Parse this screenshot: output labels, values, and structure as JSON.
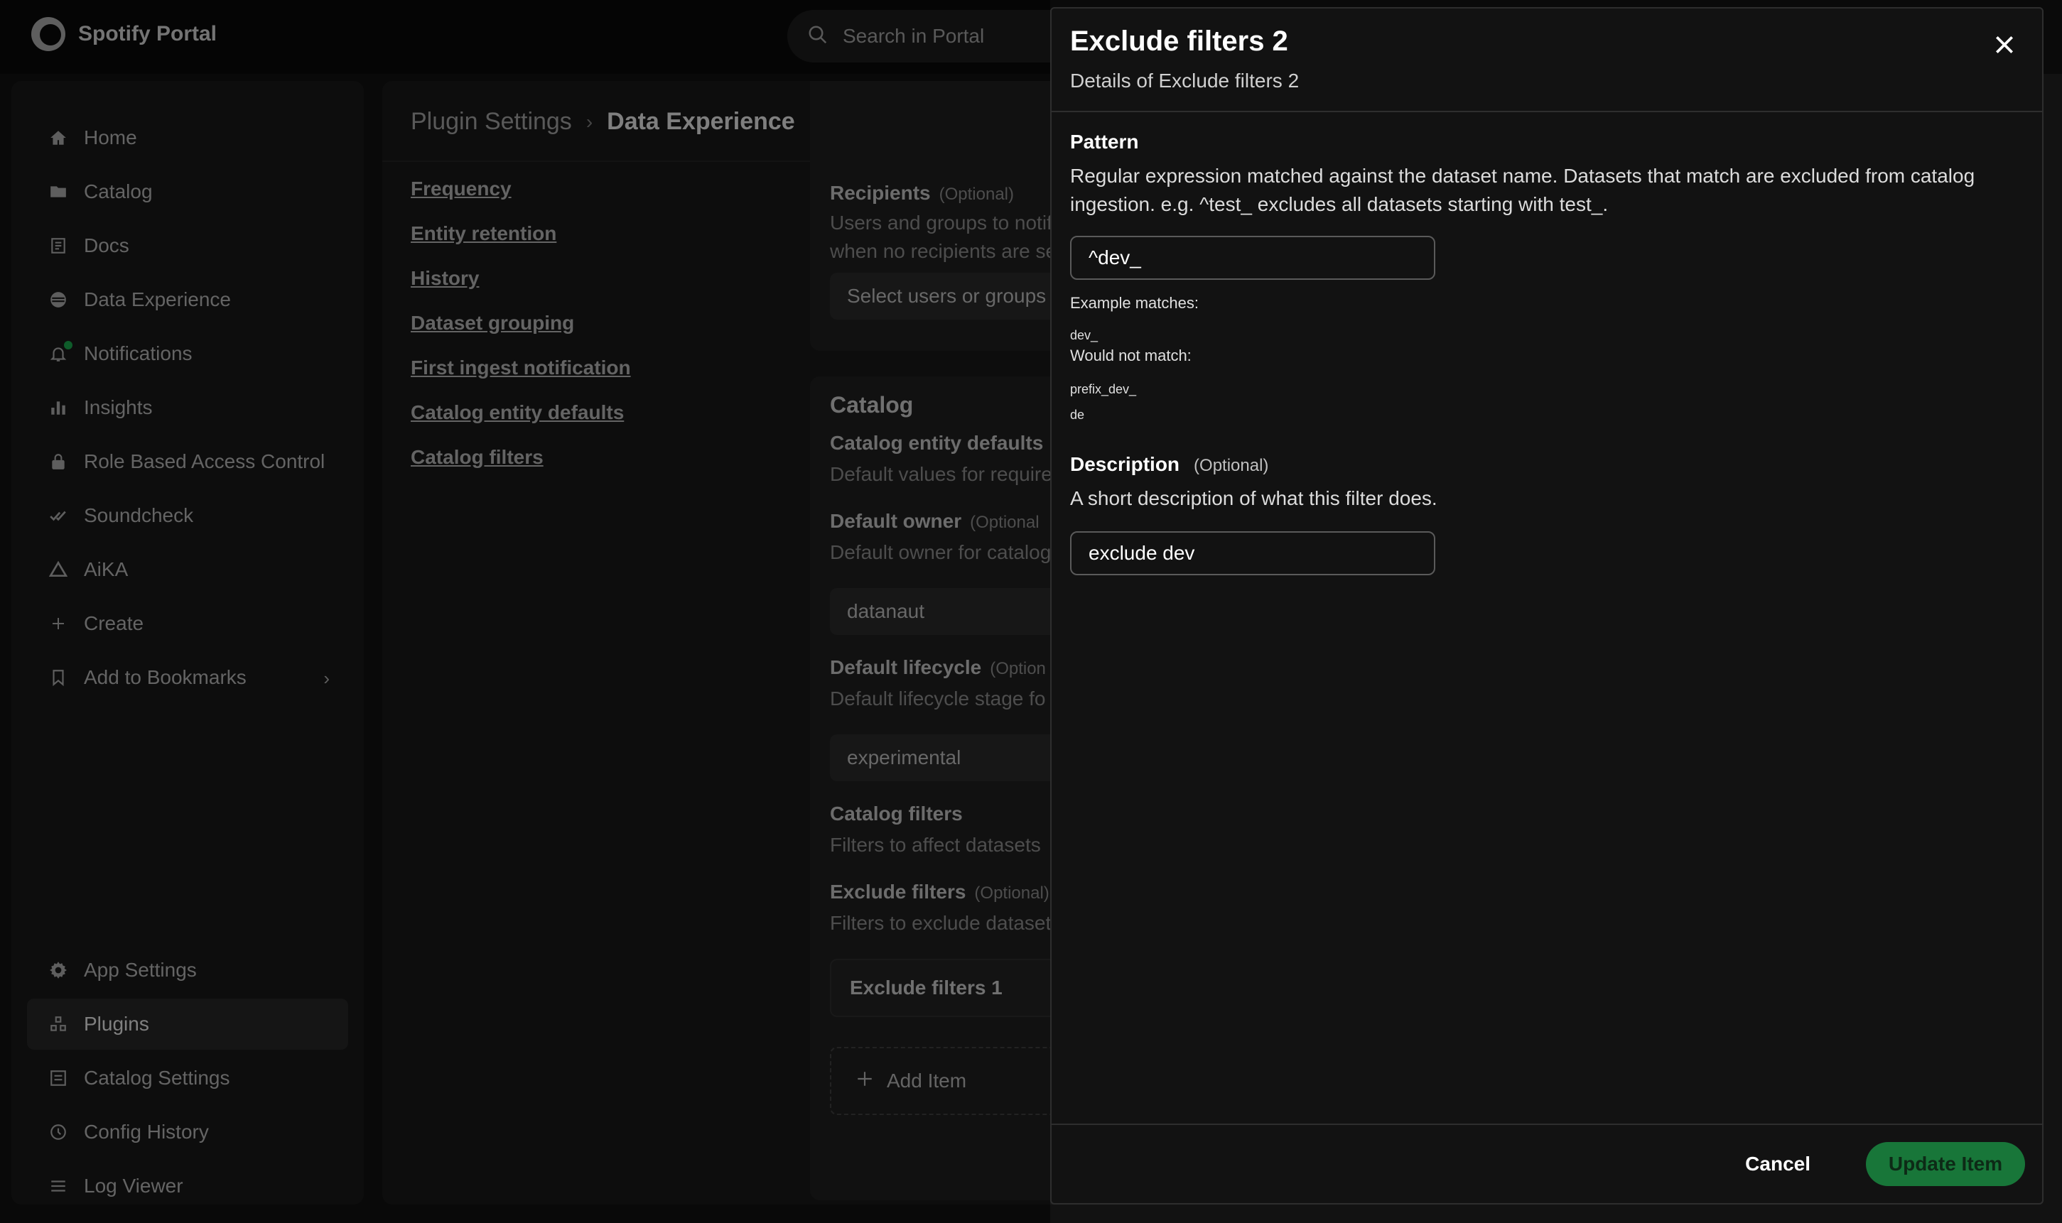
{
  "app": {
    "name": "Spotify Portal"
  },
  "search": {
    "placeholder": "Search in Portal"
  },
  "sidebar": {
    "items": [
      {
        "label": "Home",
        "icon": "home-icon"
      },
      {
        "label": "Catalog",
        "icon": "folder-icon"
      },
      {
        "label": "Docs",
        "icon": "docs-icon"
      },
      {
        "label": "Data Experience",
        "icon": "database-icon"
      },
      {
        "label": "Notifications",
        "icon": "bell-icon"
      },
      {
        "label": "Insights",
        "icon": "bar-chart-icon"
      },
      {
        "label": "Role Based Access Control",
        "icon": "lock-icon"
      },
      {
        "label": "Soundcheck",
        "icon": "check-icon"
      },
      {
        "label": "AiKA",
        "icon": "triangle-icon"
      },
      {
        "label": "Create",
        "icon": "plus-icon"
      },
      {
        "label": "Add to Bookmarks",
        "icon": "bookmark-icon"
      }
    ],
    "bottom_items": [
      {
        "label": "App Settings",
        "icon": "gear-icon"
      },
      {
        "label": "Plugins",
        "icon": "plugins-icon"
      },
      {
        "label": "Catalog Settings",
        "icon": "catalog-settings-icon"
      },
      {
        "label": "Config History",
        "icon": "history-icon"
      },
      {
        "label": "Log Viewer",
        "icon": "log-icon"
      }
    ]
  },
  "breadcrumb": {
    "parent": "Plugin Settings",
    "current": "Data Experience"
  },
  "toc": [
    "Frequency",
    "Entity retention",
    "History",
    "Dataset grouping",
    "First ingest notification",
    "Catalog entity defaults",
    "Catalog filters"
  ],
  "recipients": {
    "title": "Recipients",
    "optional": "(Optional)",
    "desc_line1": "Users and groups to notif",
    "desc_line2": "when no recipients are se",
    "placeholder": "Select users or groups"
  },
  "catalog": {
    "title": "Catalog",
    "entity_defaults_title": "Catalog entity defaults",
    "entity_defaults_desc": "Default values for require",
    "default_owner_title": "Default owner",
    "default_owner_optional": "(Optional",
    "default_owner_desc": "Default owner for catalog",
    "default_owner_value": "datanaut",
    "default_lifecycle_title": "Default lifecycle",
    "default_lifecycle_optional": "(Option",
    "default_lifecycle_desc": "Default lifecycle stage fo",
    "default_lifecycle_value": "experimental",
    "filters_title": "Catalog filters",
    "filters_desc": "Filters to affect datasets",
    "exclude_title": "Exclude filters",
    "exclude_optional": "(Optional)",
    "exclude_desc": "Filters to exclude dataset",
    "exclude_item_1": "Exclude filters 1",
    "add_item": "Add Item"
  },
  "drawer": {
    "title": "Exclude filters 2",
    "subtitle": "Details of Exclude filters 2",
    "pattern_label": "Pattern",
    "pattern_help": "Regular expression matched against the dataset name. Datasets that match are excluded from catalog ingestion. e.g. ^test_ excludes all datasets starting with test_.",
    "pattern_value": "^dev_",
    "example_matches_label": "Example matches:",
    "example_matches": [
      "dev_"
    ],
    "would_not_match_label": "Would not match:",
    "would_not_match": [
      "prefix_dev_",
      "de"
    ],
    "description_label": "Description",
    "description_optional": "(Optional)",
    "description_help": "A short description of what this filter does.",
    "description_value": "exclude dev",
    "cancel_label": "Cancel",
    "update_label": "Update Item"
  },
  "colors": {
    "accent": "#1db954",
    "background": "#121212",
    "panel": "#1a1a1a"
  }
}
